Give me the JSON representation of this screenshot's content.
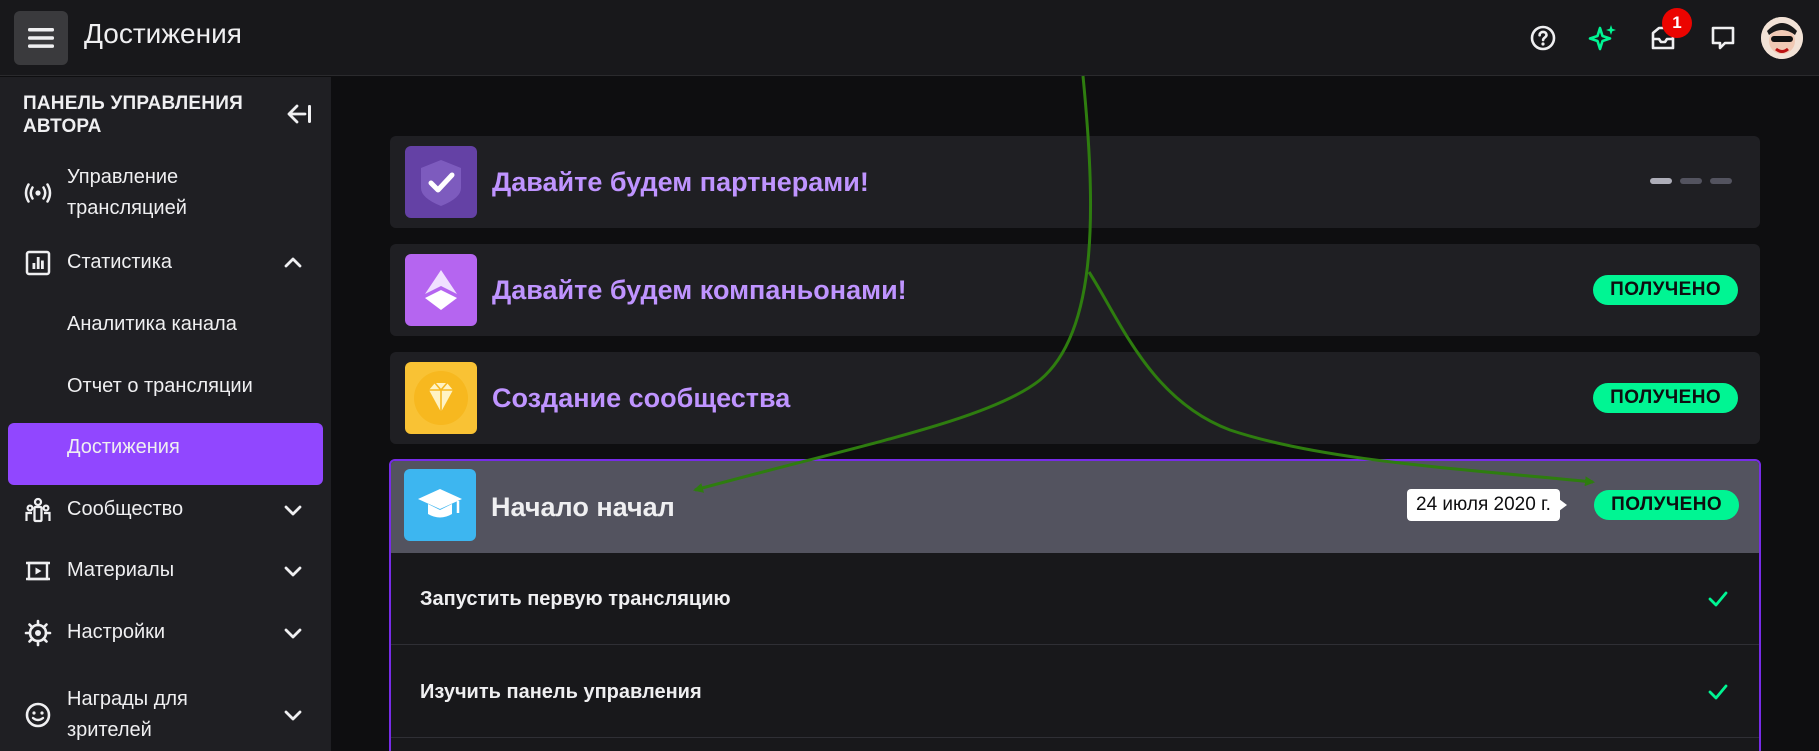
{
  "topbar": {
    "title": "Достижения",
    "notifications_count": "1",
    "icons": [
      "menu-icon",
      "help-icon",
      "sparkle-icon",
      "inbox-icon",
      "chat-icon",
      "avatar"
    ]
  },
  "sidebar": {
    "header": "ПАНЕЛЬ УПРАВЛЕНИЯ АВТОРА",
    "items": [
      {
        "label": "Управление трансляцией",
        "icon": "broadcast-icon"
      },
      {
        "label": "Статистика",
        "icon": "stats-icon",
        "expanded": true
      },
      {
        "label": "Аналитика канала",
        "sub": true
      },
      {
        "label": "Отчет о трансляции",
        "sub": true
      },
      {
        "label": "Достижения",
        "sub": true,
        "active": true
      },
      {
        "label": "Сообщество",
        "icon": "community-icon"
      },
      {
        "label": "Материалы",
        "icon": "media-icon"
      },
      {
        "label": "Настройки",
        "icon": "settings-icon"
      },
      {
        "label": "Награды для зрителей",
        "icon": "rewards-icon"
      }
    ]
  },
  "achievements": [
    {
      "title": "Давайте будем партнерами!",
      "status": "",
      "icon": "partner-badge-icon"
    },
    {
      "title": "Давайте будем компаньонами!",
      "status": "ПОЛУЧЕНО",
      "icon": "affiliate-icon"
    },
    {
      "title": "Создание сообщества",
      "status": "ПОЛУЧЕНО",
      "icon": "diamond-icon"
    },
    {
      "title": "Начало начал",
      "status": "ПОЛУЧЕНО",
      "date": "24 июля 2020 г.",
      "icon": "graduation-cap-icon"
    }
  ],
  "tasks": [
    {
      "label": "Запустить первую трансляцию",
      "done": true
    },
    {
      "label": "Изучить панель управления",
      "done": true
    }
  ],
  "colors": {
    "accent": "#9147ff",
    "accent_light": "#bf94ff",
    "success": "#00f593",
    "annotation_arrow": "#2e7d0f"
  }
}
